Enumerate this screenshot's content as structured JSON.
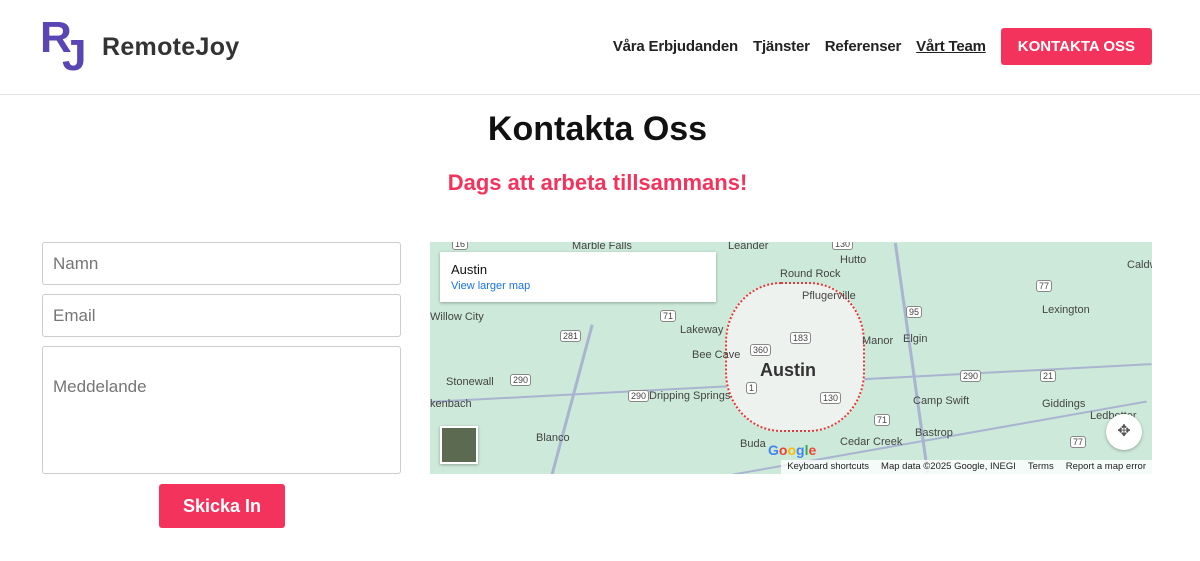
{
  "brand": {
    "mark_r": "R",
    "mark_j": "J",
    "name": "RemoteJoy",
    "color": "#5a45b5"
  },
  "nav": {
    "items": [
      {
        "label": "Våra Erbjudanden"
      },
      {
        "label": "Tjänster"
      },
      {
        "label": "Referenser"
      },
      {
        "label": "Vårt Team"
      }
    ],
    "cta": "KONTAKTA OSS"
  },
  "page": {
    "title": "Kontakta Oss",
    "subtitle": "Dags att arbeta tillsammans!"
  },
  "form": {
    "name_placeholder": "Namn",
    "email_placeholder": "Email",
    "message_placeholder": "Meddelande",
    "submit": "Skicka In"
  },
  "map": {
    "place": "Austin",
    "larger_link": "View larger map",
    "city_label": "Austin",
    "labels": [
      "Marble Falls",
      "Leander",
      "Hutto",
      "Round Rock",
      "Pflugerville",
      "Caldwell",
      "Willow City",
      "Lakeway",
      "Bee Cave",
      "Manor",
      "Elgin",
      "Lexington",
      "Stonewall",
      "Dripping Springs",
      "Camp Swift",
      "Giddings",
      "kenbach",
      "Blanco",
      "Buda",
      "Cedar Creek",
      "Bastrop",
      "Ledbetter",
      "16",
      "130",
      "281",
      "71",
      "360",
      "183",
      "95",
      "77",
      "290",
      "290",
      "290",
      "1",
      "130",
      "71",
      "21",
      "77"
    ],
    "google": "Google",
    "attribution": [
      "Keyboard shortcuts",
      "Map data ©2025 Google, INEGI",
      "Terms",
      "Report a map error"
    ]
  },
  "colors": {
    "accent": "#f4335d",
    "map_bg": "#cde9d9"
  }
}
